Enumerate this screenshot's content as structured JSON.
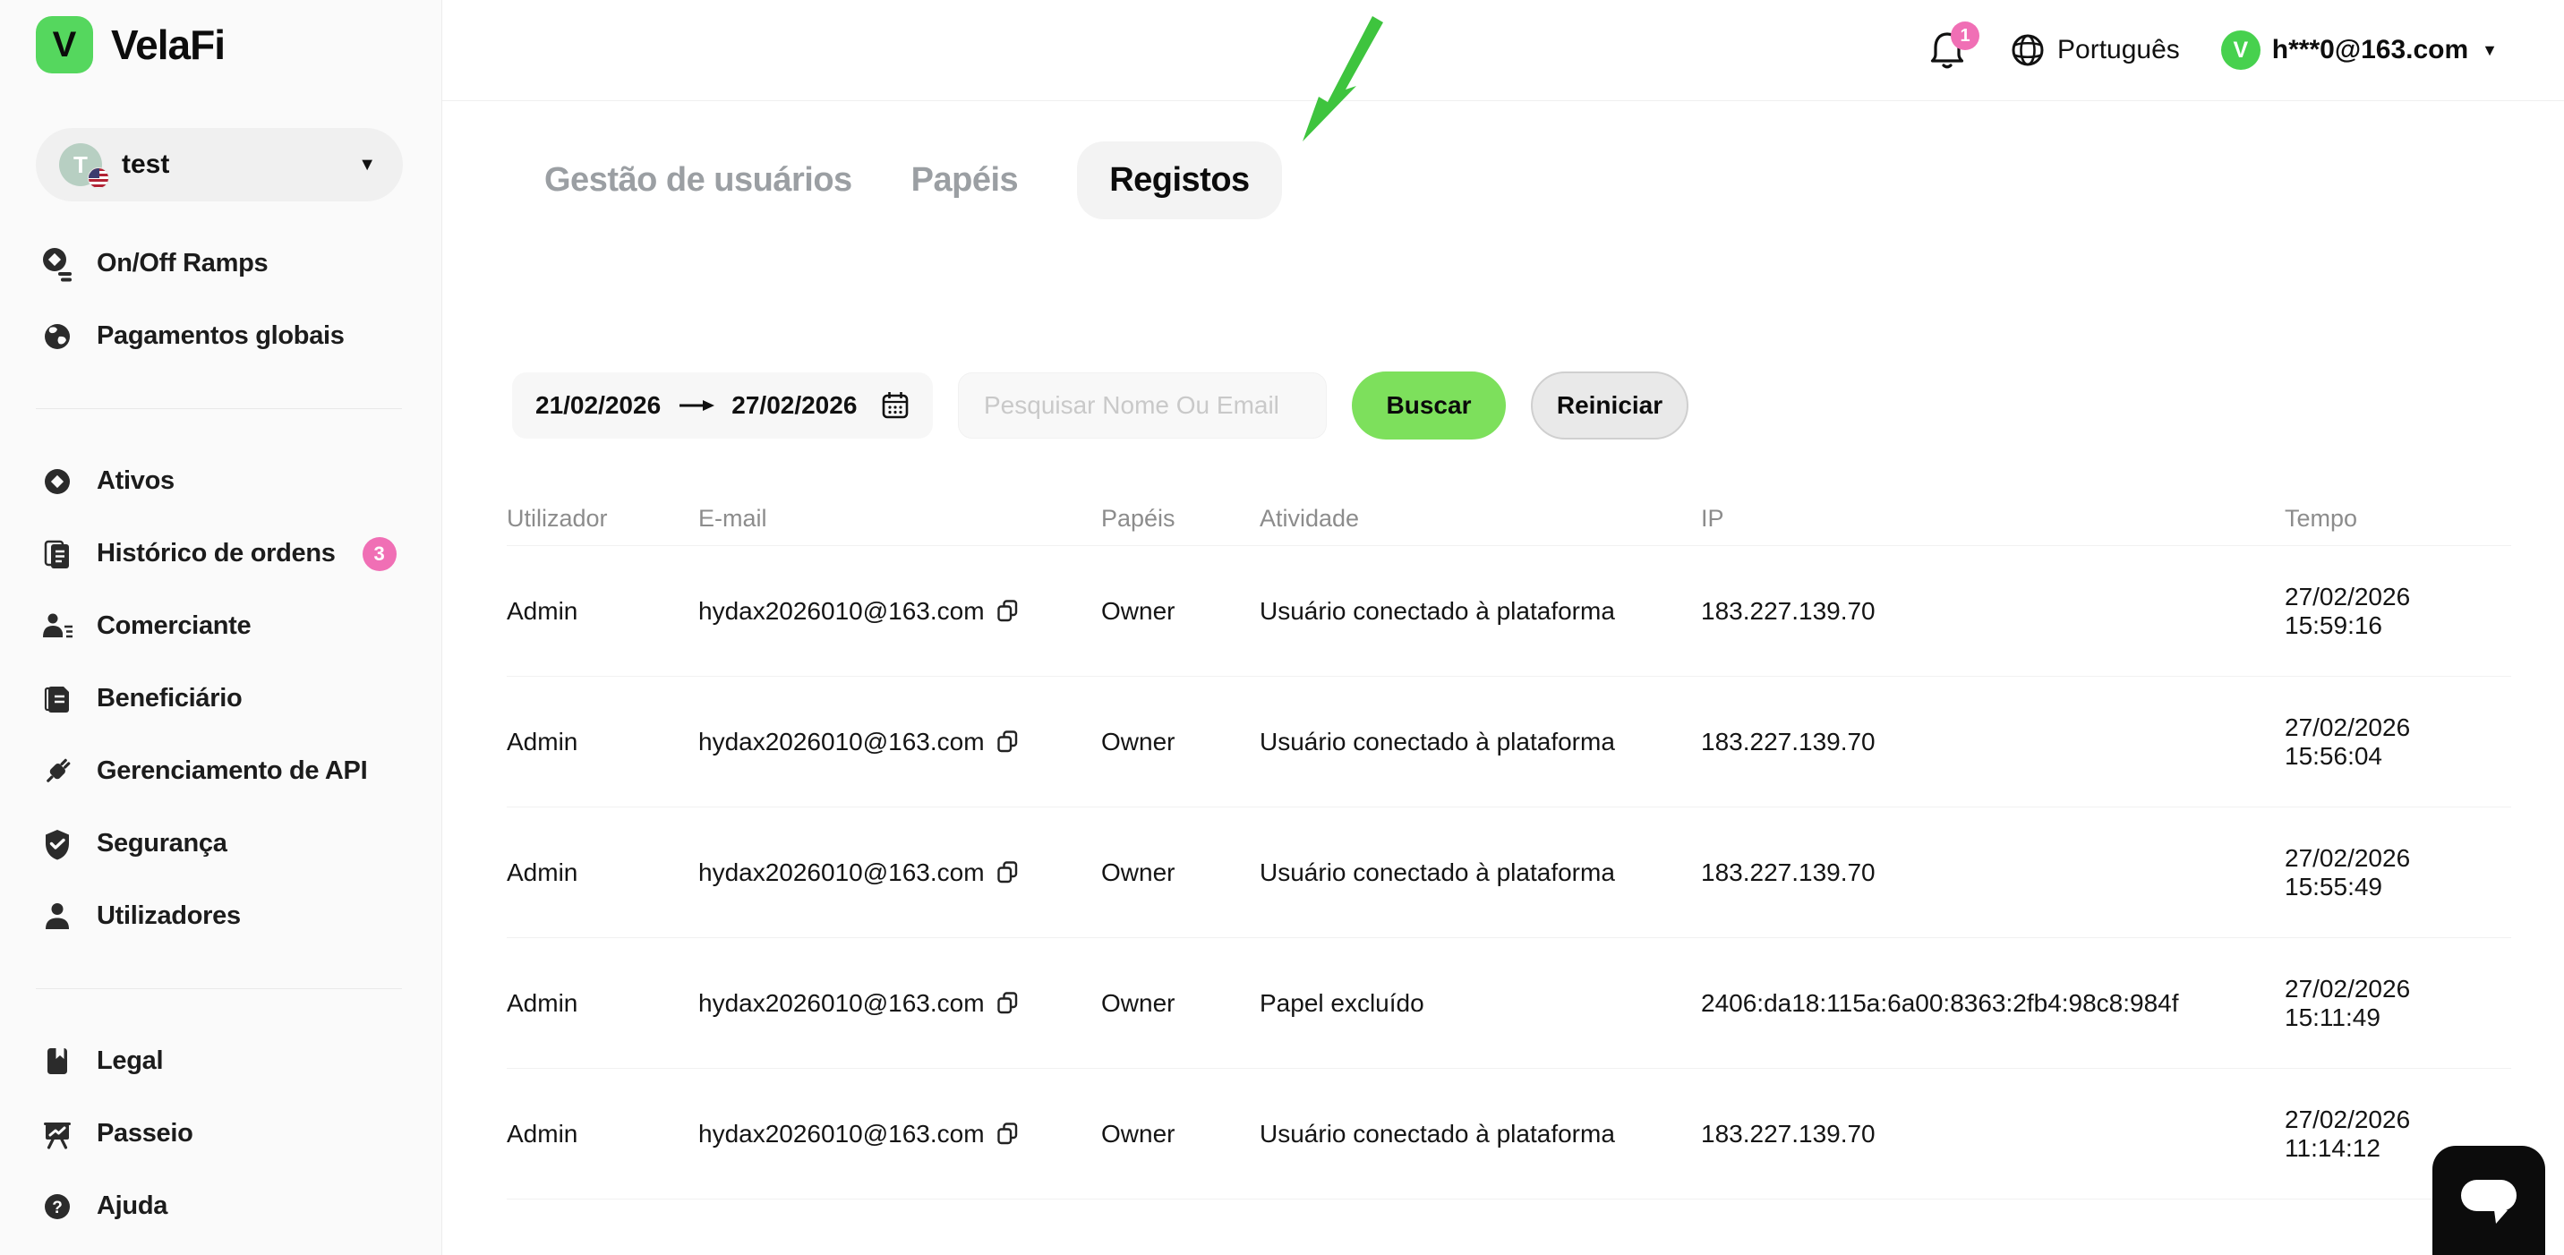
{
  "brand": {
    "name": "VelaFi",
    "logo_letter": "V"
  },
  "workspace": {
    "name": "test",
    "avatar_letter": "T"
  },
  "sidebar": {
    "items": [
      {
        "label": "On/Off Ramps"
      },
      {
        "label": "Pagamentos globais"
      },
      {
        "label": "Ativos"
      },
      {
        "label": "Histórico de ordens",
        "badge": "3"
      },
      {
        "label": "Comerciante"
      },
      {
        "label": "Beneficiário"
      },
      {
        "label": "Gerenciamento de API"
      },
      {
        "label": "Segurança"
      },
      {
        "label": "Utilizadores"
      },
      {
        "label": "Legal"
      },
      {
        "label": "Passeio"
      },
      {
        "label": "Ajuda"
      }
    ]
  },
  "header": {
    "notification_count": "1",
    "language": "Português",
    "user_email": "h***0@163.com",
    "avatar_letter": "V"
  },
  "tabs": [
    {
      "label": "Gestão de usuários",
      "active": false
    },
    {
      "label": "Papéis",
      "active": false
    },
    {
      "label": "Registos",
      "active": true
    }
  ],
  "filters": {
    "date_from": "21/02/2026",
    "date_to": "27/02/2026",
    "search_placeholder": "Pesquisar Nome Ou Email",
    "search_label": "Buscar",
    "reset_label": "Reiniciar"
  },
  "table": {
    "columns": [
      "Utilizador",
      "E-mail",
      "Papéis",
      "Atividade",
      "IP",
      "Tempo"
    ],
    "rows": [
      {
        "user": "Admin",
        "email": "hydax2026010@163.com",
        "role": "Owner",
        "activity": "Usuário conectado à plataforma",
        "ip": "183.227.139.70",
        "time": "27/02/2026 15:59:16"
      },
      {
        "user": "Admin",
        "email": "hydax2026010@163.com",
        "role": "Owner",
        "activity": "Usuário conectado à plataforma",
        "ip": "183.227.139.70",
        "time": "27/02/2026 15:56:04"
      },
      {
        "user": "Admin",
        "email": "hydax2026010@163.com",
        "role": "Owner",
        "activity": "Usuário conectado à plataforma",
        "ip": "183.227.139.70",
        "time": "27/02/2026 15:55:49"
      },
      {
        "user": "Admin",
        "email": "hydax2026010@163.com",
        "role": "Owner",
        "activity": "Papel excluído",
        "ip": "2406:da18:115a:6a00:8363:2fb4:98c8:984f",
        "time": "27/02/2026 15:11:49"
      },
      {
        "user": "Admin",
        "email": "hydax2026010@163.com",
        "role": "Owner",
        "activity": "Usuário conectado à plataforma",
        "ip": "183.227.139.70",
        "time": "27/02/2026 11:14:12"
      }
    ]
  },
  "icons": {
    "caret_down": "▼",
    "question_mark": "?"
  },
  "colors": {
    "brand_green": "#55d75e",
    "button_green": "#7de05c",
    "avatar_green": "#47d14e",
    "arrow_green": "#3ec43e",
    "badge_pink": "#f06fb5"
  }
}
